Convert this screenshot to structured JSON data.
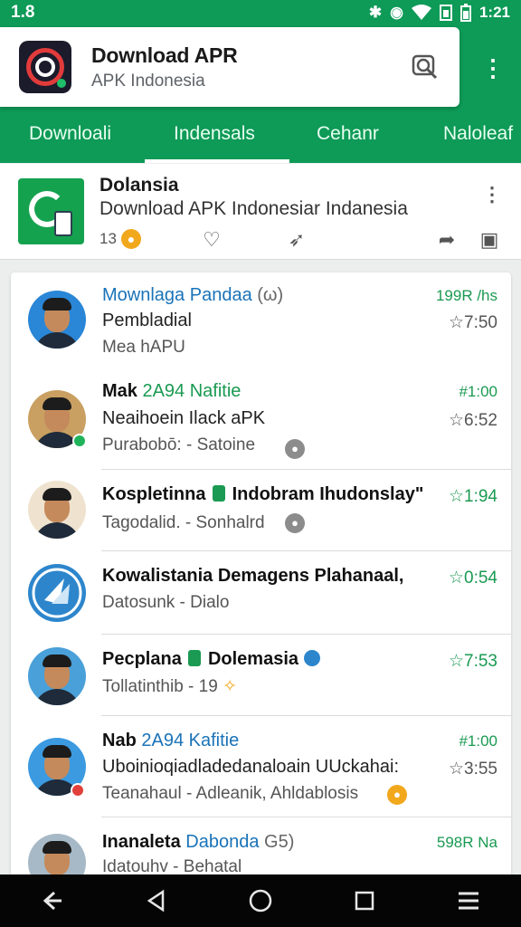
{
  "status": {
    "left": "1.8",
    "time": "1:21"
  },
  "search": {
    "title": "Download APR",
    "subtitle": "APK Indonesia"
  },
  "tabs": [
    {
      "label": "Downloali"
    },
    {
      "label": "Indensals"
    },
    {
      "label": "Cehanr"
    },
    {
      "label": "Naloleaf"
    }
  ],
  "feature": {
    "title": "Dolansia",
    "subtitle": "Download APK Indonesiar Indanesia",
    "count": "13"
  },
  "rows": [
    {
      "name_main": "Mownlaga",
      "name_accent": "Pandaa",
      "name_extra": "(ω)",
      "message": "Pembladial",
      "sub": "Mea hAPU",
      "tag": "199R /hs",
      "time": "☆7:50"
    },
    {
      "name_main": "Mak",
      "name_accent": "2A94 Nafitie",
      "message": "Neaihoein Ilack aPK",
      "sub": "Purabobō: - Satoine",
      "tag": "#1:00",
      "time": "☆6:52"
    },
    {
      "name_main": "Kospletinna",
      "name_accent": "Indobram Ihudonslay\"",
      "sub": "Tagodalid. - Sonhalrd",
      "time": "☆1:94"
    },
    {
      "name_main": "Kowalistania Demagens Plahanaal,",
      "sub": "Datosunk - Dialo",
      "time": "☆0:54"
    },
    {
      "name_main": "Pecplana",
      "name_accent": "Dolemasia",
      "sub": "Tollatinthib - 19",
      "time": "☆7:53"
    },
    {
      "name_main": "Nab",
      "name_accent": "2A94 Kafitie",
      "message": "Uboinioqiadladedanaloain UUckahai:",
      "sub": "Teanahaul - Adleanik, Ahldablosis",
      "tag": "#1:00",
      "time": "☆3:55"
    },
    {
      "name_main": "Inanaleta",
      "name_accent": "Dabonda",
      "name_extra": "G5)",
      "sub": "Idatouhv - Behatal",
      "tag": "598R Na"
    }
  ],
  "colors": {
    "brand_green": "#0e9a57",
    "link_blue": "#1a73b8",
    "accent_green": "#1a9a52",
    "coin_orange": "#f2a81d"
  }
}
